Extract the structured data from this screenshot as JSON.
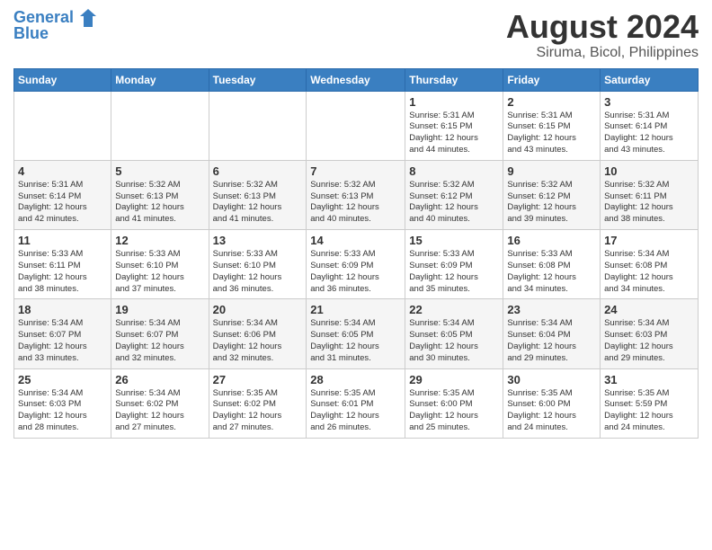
{
  "logo": {
    "line1": "General",
    "line2": "Blue"
  },
  "title": "August 2024",
  "subtitle": "Siruma, Bicol, Philippines",
  "days_of_week": [
    "Sunday",
    "Monday",
    "Tuesday",
    "Wednesday",
    "Thursday",
    "Friday",
    "Saturday"
  ],
  "weeks": [
    [
      {
        "day": "",
        "info": ""
      },
      {
        "day": "",
        "info": ""
      },
      {
        "day": "",
        "info": ""
      },
      {
        "day": "",
        "info": ""
      },
      {
        "day": "1",
        "info": "Sunrise: 5:31 AM\nSunset: 6:15 PM\nDaylight: 12 hours\nand 44 minutes."
      },
      {
        "day": "2",
        "info": "Sunrise: 5:31 AM\nSunset: 6:15 PM\nDaylight: 12 hours\nand 43 minutes."
      },
      {
        "day": "3",
        "info": "Sunrise: 5:31 AM\nSunset: 6:14 PM\nDaylight: 12 hours\nand 43 minutes."
      }
    ],
    [
      {
        "day": "4",
        "info": "Sunrise: 5:31 AM\nSunset: 6:14 PM\nDaylight: 12 hours\nand 42 minutes."
      },
      {
        "day": "5",
        "info": "Sunrise: 5:32 AM\nSunset: 6:13 PM\nDaylight: 12 hours\nand 41 minutes."
      },
      {
        "day": "6",
        "info": "Sunrise: 5:32 AM\nSunset: 6:13 PM\nDaylight: 12 hours\nand 41 minutes."
      },
      {
        "day": "7",
        "info": "Sunrise: 5:32 AM\nSunset: 6:13 PM\nDaylight: 12 hours\nand 40 minutes."
      },
      {
        "day": "8",
        "info": "Sunrise: 5:32 AM\nSunset: 6:12 PM\nDaylight: 12 hours\nand 40 minutes."
      },
      {
        "day": "9",
        "info": "Sunrise: 5:32 AM\nSunset: 6:12 PM\nDaylight: 12 hours\nand 39 minutes."
      },
      {
        "day": "10",
        "info": "Sunrise: 5:32 AM\nSunset: 6:11 PM\nDaylight: 12 hours\nand 38 minutes."
      }
    ],
    [
      {
        "day": "11",
        "info": "Sunrise: 5:33 AM\nSunset: 6:11 PM\nDaylight: 12 hours\nand 38 minutes."
      },
      {
        "day": "12",
        "info": "Sunrise: 5:33 AM\nSunset: 6:10 PM\nDaylight: 12 hours\nand 37 minutes."
      },
      {
        "day": "13",
        "info": "Sunrise: 5:33 AM\nSunset: 6:10 PM\nDaylight: 12 hours\nand 36 minutes."
      },
      {
        "day": "14",
        "info": "Sunrise: 5:33 AM\nSunset: 6:09 PM\nDaylight: 12 hours\nand 36 minutes."
      },
      {
        "day": "15",
        "info": "Sunrise: 5:33 AM\nSunset: 6:09 PM\nDaylight: 12 hours\nand 35 minutes."
      },
      {
        "day": "16",
        "info": "Sunrise: 5:33 AM\nSunset: 6:08 PM\nDaylight: 12 hours\nand 34 minutes."
      },
      {
        "day": "17",
        "info": "Sunrise: 5:34 AM\nSunset: 6:08 PM\nDaylight: 12 hours\nand 34 minutes."
      }
    ],
    [
      {
        "day": "18",
        "info": "Sunrise: 5:34 AM\nSunset: 6:07 PM\nDaylight: 12 hours\nand 33 minutes."
      },
      {
        "day": "19",
        "info": "Sunrise: 5:34 AM\nSunset: 6:07 PM\nDaylight: 12 hours\nand 32 minutes."
      },
      {
        "day": "20",
        "info": "Sunrise: 5:34 AM\nSunset: 6:06 PM\nDaylight: 12 hours\nand 32 minutes."
      },
      {
        "day": "21",
        "info": "Sunrise: 5:34 AM\nSunset: 6:05 PM\nDaylight: 12 hours\nand 31 minutes."
      },
      {
        "day": "22",
        "info": "Sunrise: 5:34 AM\nSunset: 6:05 PM\nDaylight: 12 hours\nand 30 minutes."
      },
      {
        "day": "23",
        "info": "Sunrise: 5:34 AM\nSunset: 6:04 PM\nDaylight: 12 hours\nand 29 minutes."
      },
      {
        "day": "24",
        "info": "Sunrise: 5:34 AM\nSunset: 6:03 PM\nDaylight: 12 hours\nand 29 minutes."
      }
    ],
    [
      {
        "day": "25",
        "info": "Sunrise: 5:34 AM\nSunset: 6:03 PM\nDaylight: 12 hours\nand 28 minutes."
      },
      {
        "day": "26",
        "info": "Sunrise: 5:34 AM\nSunset: 6:02 PM\nDaylight: 12 hours\nand 27 minutes."
      },
      {
        "day": "27",
        "info": "Sunrise: 5:35 AM\nSunset: 6:02 PM\nDaylight: 12 hours\nand 27 minutes."
      },
      {
        "day": "28",
        "info": "Sunrise: 5:35 AM\nSunset: 6:01 PM\nDaylight: 12 hours\nand 26 minutes."
      },
      {
        "day": "29",
        "info": "Sunrise: 5:35 AM\nSunset: 6:00 PM\nDaylight: 12 hours\nand 25 minutes."
      },
      {
        "day": "30",
        "info": "Sunrise: 5:35 AM\nSunset: 6:00 PM\nDaylight: 12 hours\nand 24 minutes."
      },
      {
        "day": "31",
        "info": "Sunrise: 5:35 AM\nSunset: 5:59 PM\nDaylight: 12 hours\nand 24 minutes."
      }
    ]
  ]
}
